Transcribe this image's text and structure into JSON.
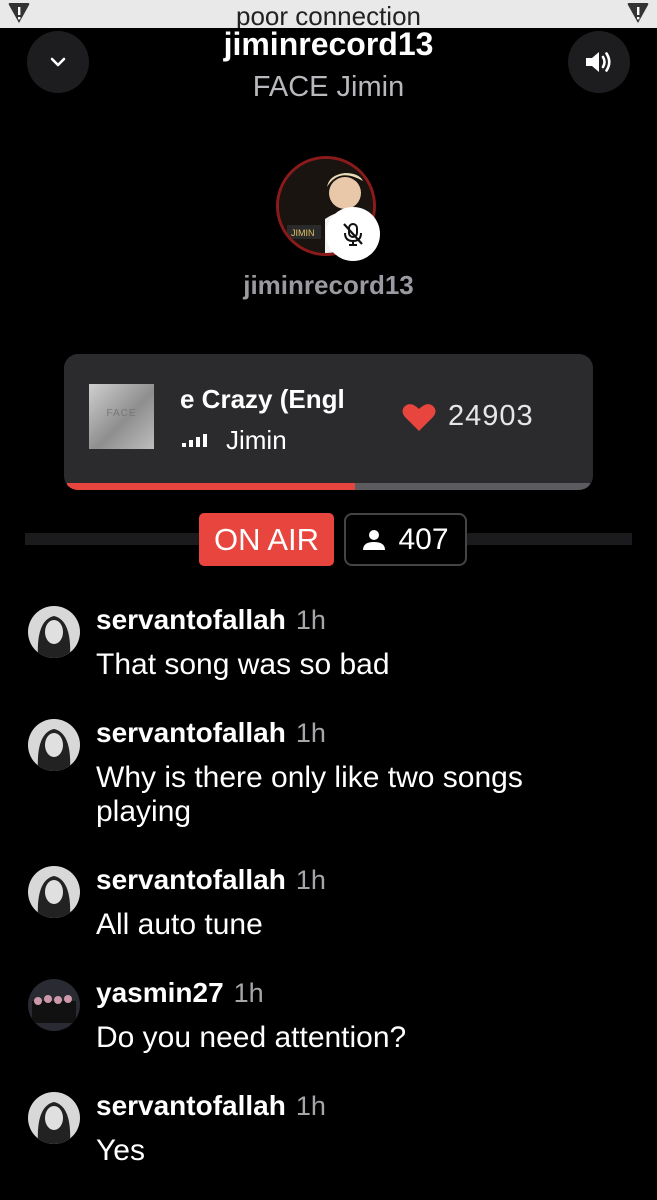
{
  "banner": {
    "text": "poor connection"
  },
  "header": {
    "room_title": "jiminrecord13",
    "room_subtitle": "FACE Jimin",
    "collapse_icon": "chevron-down-icon",
    "volume_icon": "speaker-icon"
  },
  "host": {
    "name": "jiminrecord13",
    "mic_status_icon": "mic-muted-icon"
  },
  "now_playing": {
    "title_visible": "e Crazy (Engl",
    "artist": "Jimin",
    "likes": "24903",
    "progress": 0.55,
    "cover_text": "FACE"
  },
  "status": {
    "on_air_label": "ON AIR",
    "listener_count": "407"
  },
  "chat": [
    {
      "user": "servantofallah",
      "time": "1h",
      "text": "That song was so bad"
    },
    {
      "user": "servantofallah",
      "time": "1h",
      "text": "Why is there only like two songs playing"
    },
    {
      "user": "servantofallah",
      "time": "1h",
      "text": "All auto tune"
    },
    {
      "user": "yasmin27",
      "time": "1h",
      "text": "Do you need attention?"
    },
    {
      "user": "servantofallah",
      "time": "1h",
      "text": "Yes"
    }
  ],
  "colors": {
    "accent": "#e8453e",
    "background": "#000000",
    "card": "#2b2b2e"
  }
}
